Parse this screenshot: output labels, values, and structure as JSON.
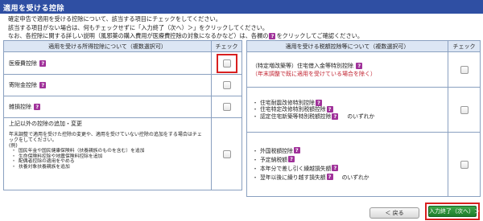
{
  "header": {
    "title": "適用を受ける控除"
  },
  "intro": [
    "確定申告で適用を受ける控除について、該当する項目にチェックをしてください。",
    "該当する項目がない場合は、何もチェックせずに「入力終了（次へ）＞」をクリックしてください。",
    "なお、各控除に関する詳しい説明（風邪薬の購入費用が医療費控除の対象になるかなど）は、各欄の",
    "をクリックしてご確認ください。"
  ],
  "help_glyph": "?",
  "left_table": {
    "header": "適用を受ける所得控除について（複数選択可）",
    "check_header": "チェック",
    "rows": {
      "medical": "医療費控除",
      "donation": "寄附金控除",
      "casualty": "雑損控除",
      "other_title": "上記以外の控除の追加・変更",
      "other_desc_1": "年末調整で適用を受けた控除の変更や、適用を受けていない控除の追加をする場合はチェ",
      "other_desc_2": "ックをしてください。",
      "other_example": "(例)",
      "other_items": [
        "国民年金や国民健康保険料（扶養親族のものを含む）を追加",
        "生命保険料控除や地震保険料控除を追加",
        "配偶者控除の適用をやめる",
        "扶養対象扶養親族を追加"
      ]
    }
  },
  "right_table": {
    "header": "適用を受ける税額控除等について（複数選択可）",
    "check_header": "チェック",
    "rows": {
      "housing_loan": "（特定増改築等）住宅借入金等特別控除",
      "housing_loan_note": "（年末調整で既に適用を受けている場合を除く）",
      "group2": [
        "住宅耐震改修特別控除",
        "住宅特定改修特別税額控除",
        "認定住宅新築等特別税額控除"
      ],
      "group2_suffix": "のいずれか",
      "group3": [
        "外国税額控除",
        "予定納税額",
        "本年分で差し引く繰越損失額",
        "翌年以後に繰り越す損失額"
      ],
      "group3_suffix": "のいずれか"
    }
  },
  "buttons": {
    "back": "＜ 戻る",
    "next": "入力終了（次へ）＞"
  },
  "colors": {
    "title_bar": "#2f4fa3",
    "help_icon": "#a0329a",
    "highlight": "#d82020",
    "next_button": "#1e7d2b"
  }
}
